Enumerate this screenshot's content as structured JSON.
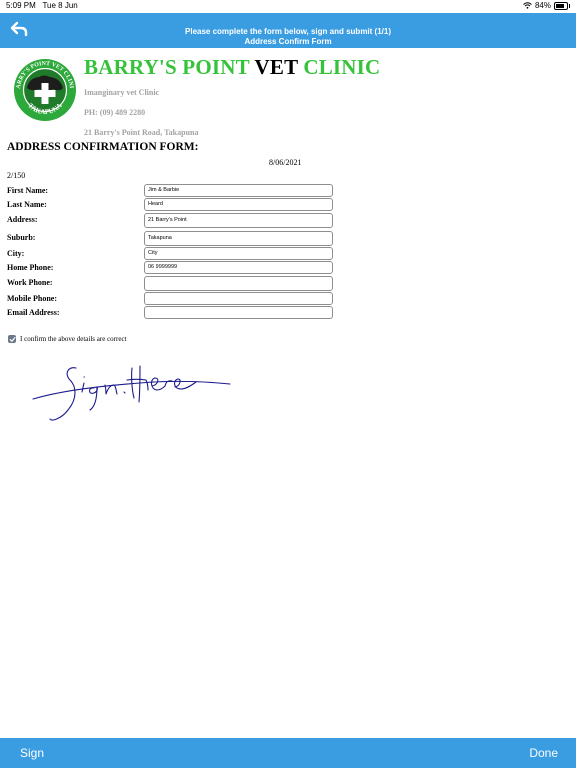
{
  "status_bar": {
    "time": "5:09 PM",
    "date": "Tue 8 Jun",
    "battery": "84%",
    "battery_level": 0.84,
    "icons": [
      "wifi-icon",
      "battery-icon"
    ]
  },
  "nav": {
    "back_icon": "back-arrow-icon",
    "title_line1": "Please complete the form below, sign and submit  (1/1)",
    "title_line2": "Address Confirm Form"
  },
  "header": {
    "logo_icon": "clinic-logo-icon",
    "logo_text": "BARRY'S POINT VET CLINIC TAKAPUNA",
    "name_part1": "BARRY'S POINT",
    "name_part2": "VET",
    "name_part3": "CLINIC",
    "subtitle": "Imanginary vet Clinic",
    "phone": "PH: (09) 489 2280",
    "address": "21 Barry's Point Road, Takapuna"
  },
  "form": {
    "title": "ADDRESS CONFIRMATION FORM:",
    "date": "8/06/2021",
    "reference": "2/150",
    "fields": [
      {
        "label": "First Name:",
        "value": "Jim & Barbie"
      },
      {
        "label": "Last Name:",
        "value": "Heard"
      },
      {
        "label": "Address:",
        "value": "21 Barry's Point"
      },
      {
        "label": "Suburb:",
        "value": "Takapuna"
      },
      {
        "label": "City:",
        "value": "City"
      },
      {
        "label": "Home Phone:",
        "value": "06 9999999"
      },
      {
        "label": "Work Phone:",
        "value": ""
      },
      {
        "label": "Mobile Phone:",
        "value": ""
      },
      {
        "label": "Email Address:",
        "value": ""
      }
    ],
    "confirm_checked": true,
    "confirm_label": "I confirm the above details are correct"
  },
  "signature": {
    "text": "Sign here",
    "color": "#1a1a8c"
  },
  "bottom_bar": {
    "sign_label": "Sign",
    "done_label": "Done"
  },
  "colors": {
    "accent": "#3a9de2",
    "brand_green": "#35c33a"
  }
}
